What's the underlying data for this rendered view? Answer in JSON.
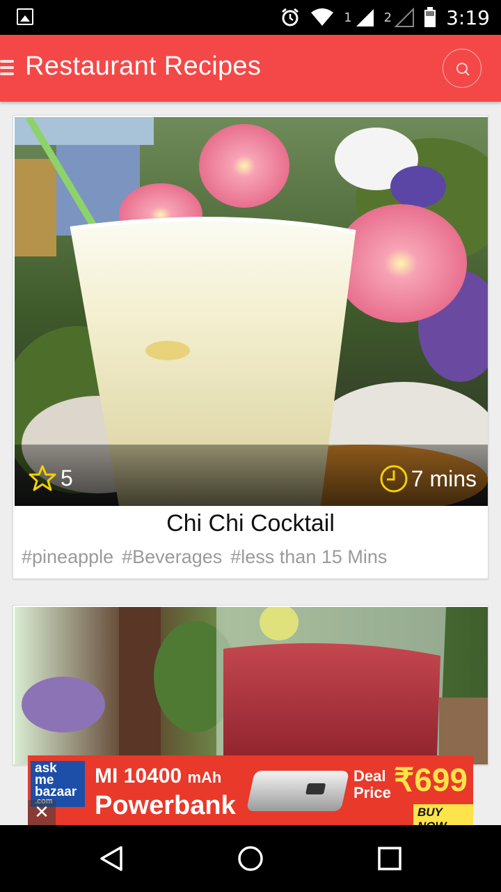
{
  "status_bar": {
    "time": "3:19",
    "sim1": "1",
    "sim2": "2"
  },
  "app_bar": {
    "title": "Restaurant Recipes"
  },
  "recipes": [
    {
      "title": "Chi Chi Cocktail",
      "rating": "5",
      "duration": "7 mins",
      "tags": [
        "#pineapple",
        "#Beverages",
        "#less than 15 Mins"
      ]
    },
    {
      "title": "",
      "rating": "",
      "duration": "",
      "tags": []
    }
  ],
  "ad": {
    "logo_top": "ask",
    "logo_mid": "me",
    "logo_bottom": "bazaar",
    "logo_suffix": ".com",
    "product_model": "MI 10400",
    "product_unit": "mAh",
    "product_name": "Powerbank",
    "deal_line1": "Deal",
    "deal_line2": "Price",
    "price": "₹699",
    "cta": "BUY NOW",
    "close": "✕"
  },
  "colors": {
    "app_bar": "#f44848",
    "star": "#f5d000",
    "clock": "#f5d000",
    "ad_bg": "#e8392a",
    "ad_price": "#ffe34a"
  }
}
